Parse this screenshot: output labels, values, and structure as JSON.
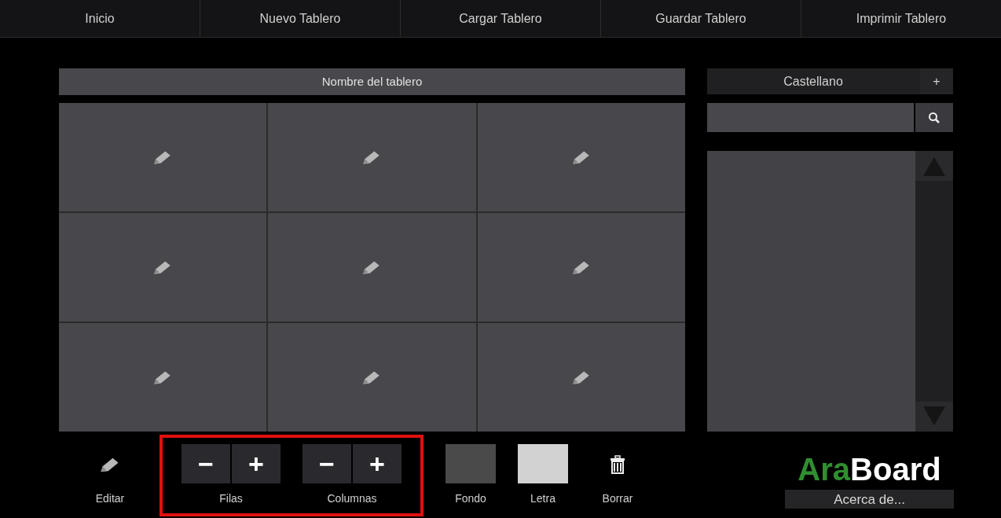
{
  "menu": [
    {
      "label": "Inicio"
    },
    {
      "label": "Nuevo Tablero"
    },
    {
      "label": "Cargar Tablero"
    },
    {
      "label": "Guardar Tablero"
    },
    {
      "label": "Imprimir Tablero"
    }
  ],
  "board": {
    "title": "Nombre del tablero"
  },
  "language": {
    "label": "Castellano",
    "add": "+"
  },
  "toolbar": [
    {
      "kind": "edit",
      "label": "Editar"
    },
    {
      "kind": "group",
      "highlighted": true,
      "items": [
        {
          "kind": "stepper",
          "label": "Filas",
          "minus": "−",
          "plus": "+"
        },
        {
          "kind": "stepper",
          "label": "Columnas",
          "minus": "−",
          "plus": "+"
        }
      ]
    },
    {
      "kind": "swatch",
      "label": "Fondo",
      "color": "#4a4a4a"
    },
    {
      "kind": "swatch",
      "label": "Letra",
      "color": "#d2d2d2"
    },
    {
      "kind": "delete",
      "label": "Borrar"
    }
  ],
  "logo": {
    "first": "Ara",
    "second": "Board"
  },
  "about_button": "Acerca de..."
}
